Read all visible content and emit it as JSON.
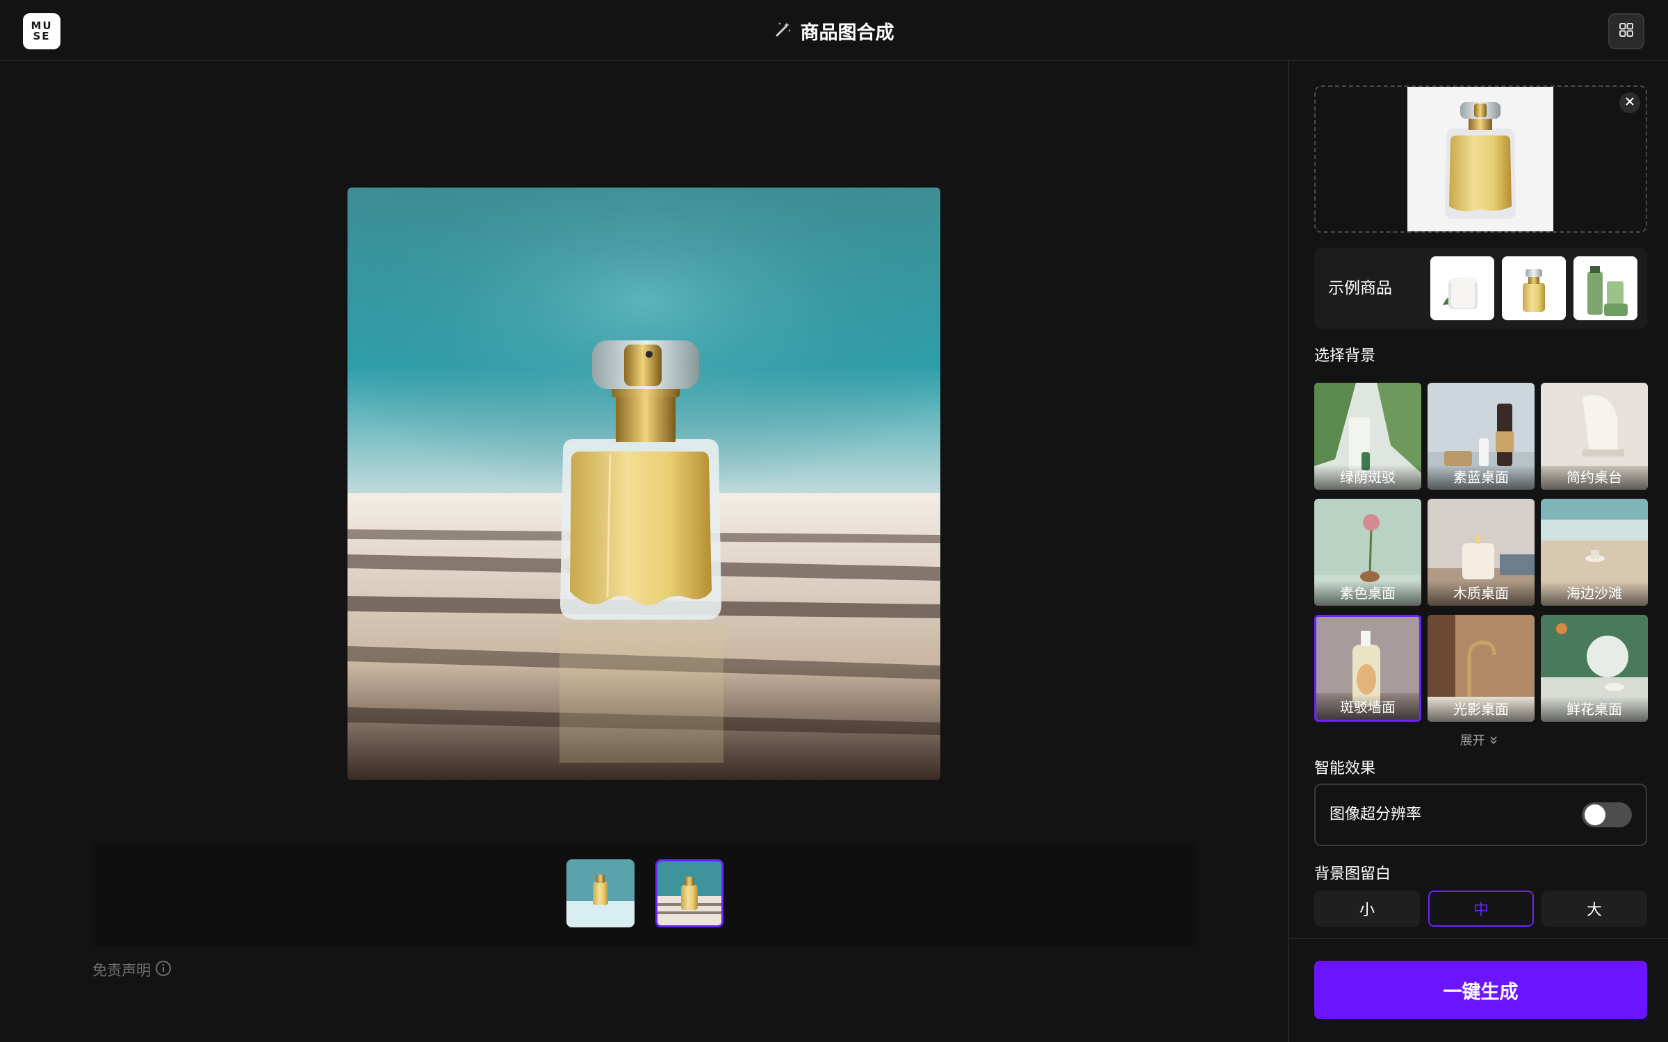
{
  "app": {
    "logo_line1": "MU",
    "logo_line2": "SE",
    "title": "商品图合成",
    "title_icon": "magic-wand-icon",
    "layout_icon": "grid-icon"
  },
  "preview": {
    "thumbnails": [
      {
        "name": "result-thumbnail-1",
        "selected": false
      },
      {
        "name": "result-thumbnail-2",
        "selected": true
      }
    ],
    "disclaimer": "免责声明"
  },
  "panel": {
    "upload": {
      "close_icon": "close-icon"
    },
    "examples": {
      "label": "示例商品",
      "items": [
        "candle",
        "perfume",
        "skincare"
      ]
    },
    "background": {
      "label": "选择背景",
      "tiles": [
        {
          "label": "绿荫斑驳",
          "selected": false
        },
        {
          "label": "素蓝桌面",
          "selected": false
        },
        {
          "label": "简约桌台",
          "selected": false
        },
        {
          "label": "素色桌面",
          "selected": false
        },
        {
          "label": "木质桌面",
          "selected": false
        },
        {
          "label": "海边沙滩",
          "selected": false
        },
        {
          "label": "斑驳墙面",
          "selected": true
        },
        {
          "label": "光影桌面",
          "selected": false
        },
        {
          "label": "鲜花桌面",
          "selected": false
        }
      ],
      "expand": "展开"
    },
    "smart_effect": {
      "label": "智能效果",
      "super_resolution": "图像超分辨率",
      "super_resolution_on": false
    },
    "padding": {
      "label": "背景图留白",
      "options": [
        "小",
        "中",
        "大"
      ],
      "selected": "中"
    },
    "generate": "一键生成"
  },
  "colors": {
    "accent": "#6a14ff",
    "background": "#131313",
    "panel_card": "#1c1c1c"
  }
}
